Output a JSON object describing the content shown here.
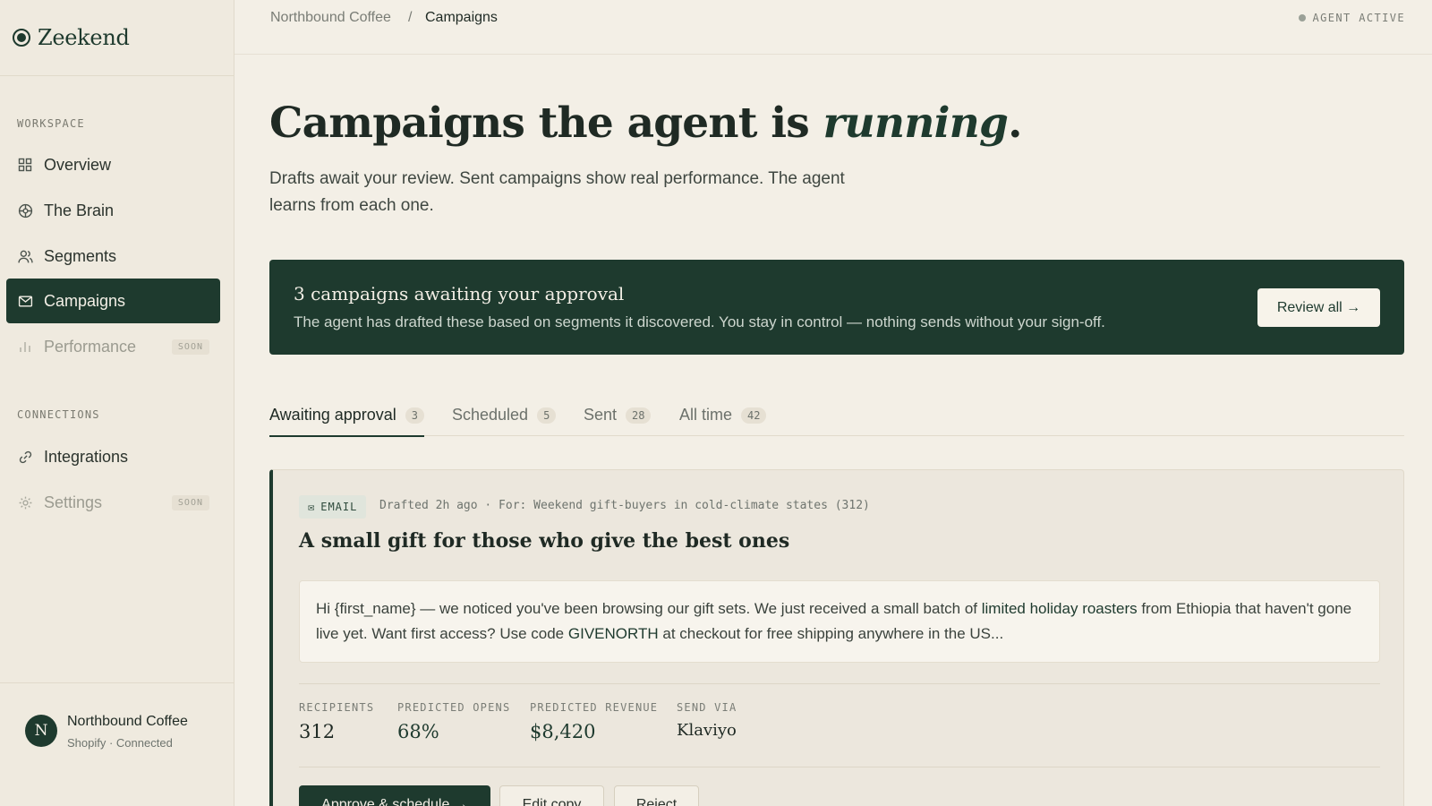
{
  "brand": {
    "name": "Zeekend"
  },
  "sidebar": {
    "workspace_label": "WORKSPACE",
    "connections_label": "CONNECTIONS",
    "items": [
      {
        "label": "Overview",
        "icon": "grid-icon"
      },
      {
        "label": "The Brain",
        "icon": "brain-icon"
      },
      {
        "label": "Segments",
        "icon": "users-icon"
      },
      {
        "label": "Campaigns",
        "icon": "mail-icon",
        "active": true
      },
      {
        "label": "Performance",
        "icon": "bar-chart-icon",
        "badge": "SOON"
      },
      {
        "label": "Integrations",
        "icon": "link-icon"
      },
      {
        "label": "Settings",
        "icon": "gear-icon",
        "badge": "SOON"
      }
    ]
  },
  "account": {
    "initial": "N",
    "name": "Northbound Coffee",
    "sub": "Shopify · Connected"
  },
  "header": {
    "breadcrumb": [
      "Northbound Coffee",
      "Campaigns"
    ],
    "separator": "/",
    "agent_status": "AGENT ACTIVE"
  },
  "hero": {
    "title_prefix": "Campaigns the agent is ",
    "title_emphasis": "running",
    "title_suffix": ".",
    "description": "Drafts await your review. Sent campaigns show real performance. The agent learns from each one."
  },
  "banner": {
    "title": "3 campaigns awaiting your approval",
    "text": "The agent has drafted these based on segments it discovered. You stay in control — nothing sends without your sign-off.",
    "button": "Review all →"
  },
  "tabs": [
    {
      "label": "Awaiting approval",
      "count": "3"
    },
    {
      "label": "Scheduled",
      "count": "5"
    },
    {
      "label": "Sent",
      "count": "28"
    },
    {
      "label": "All time",
      "count": "42"
    }
  ],
  "campaign": {
    "channel": "EMAIL",
    "meta": "Drafted 2h ago · For: Weekend gift-buyers in cold-climate states (312)",
    "title": "A small gift for those who give the best ones",
    "preview": {
      "part1": "Hi {first_name} — we noticed you've been browsing our gift sets. We just received a small batch of ",
      "highlight1": "limited holiday roasters",
      "part2": " from Ethiopia that haven't gone live yet. Want first access? Use code ",
      "highlight2": "GIVENORTH",
      "part3": " at checkout for free shipping anywhere in the US..."
    },
    "stats": [
      {
        "label": "RECIPIENTS",
        "value": "312"
      },
      {
        "label": "PREDICTED OPENS",
        "value": "68%"
      },
      {
        "label": "PREDICTED REVENUE",
        "value": "$8,420"
      },
      {
        "label": "SEND VIA",
        "value": "Klaviyo"
      }
    ],
    "actions": {
      "approve": "Approve & schedule →",
      "edit": "Edit copy",
      "reject": "Reject"
    }
  },
  "colors": {
    "accent": "#1e3a2e",
    "background": "#f3efe6"
  }
}
